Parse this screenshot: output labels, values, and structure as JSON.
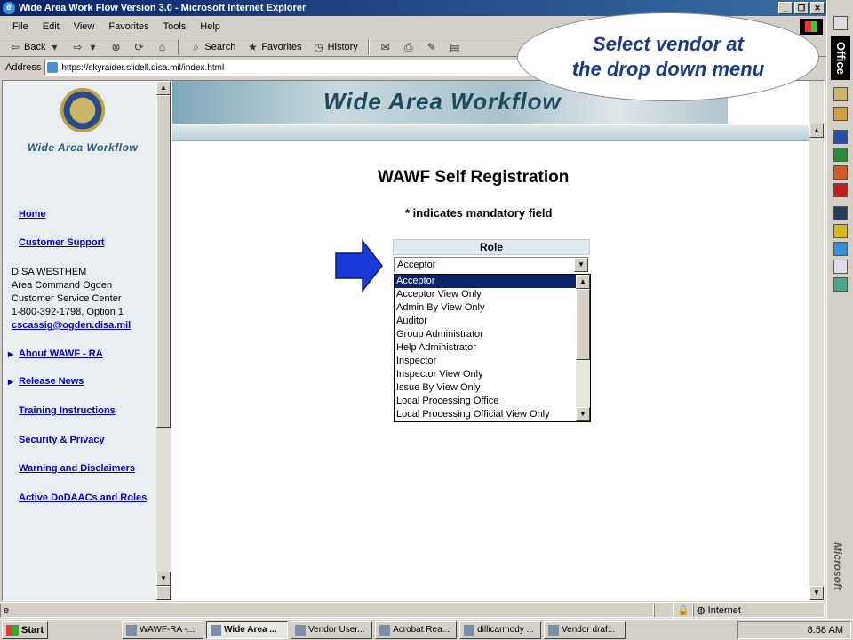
{
  "window": {
    "title": "Wide Area Work Flow Version 3.0 - Microsoft Internet Explorer",
    "controls": [
      "_",
      "❐",
      "✕"
    ]
  },
  "menu": [
    "File",
    "Edit",
    "View",
    "Favorites",
    "Tools",
    "Help"
  ],
  "toolbar": {
    "back": "Back",
    "search": "Search",
    "favorites": "Favorites",
    "history": "History"
  },
  "address": {
    "label": "Address",
    "url": "https://skyraider.slidell.disa.mil/index.html"
  },
  "callout": {
    "line1": "Select vendor at",
    "line2": "the drop down menu"
  },
  "sidebar": {
    "logo_text": "Wide Area Workflow",
    "links": {
      "home": "Home",
      "support": "Customer Support",
      "about": "About WAWF - RA",
      "release": "Release News",
      "training": "Training Instructions",
      "security": "Security & Privacy",
      "warning": "Warning and Disclaimers",
      "active": "Active DoDAACs and Roles"
    },
    "contact": {
      "line1": "DISA WESTHEM",
      "line2": "Area Command Ogden",
      "line3": "Customer Service Center",
      "line4": "1-800-392-1798, Option 1",
      "email": "cscassig@ogden.disa.mil"
    }
  },
  "banner": {
    "title": "Wide Area Workflow"
  },
  "form": {
    "title": "WAWF Self Registration",
    "subtitle": "* indicates mandatory field",
    "role_label": "Role",
    "selected_role": "Acceptor",
    "options": [
      "Acceptor",
      "Acceptor View Only",
      "Admin By View Only",
      "Auditor",
      "Group Administrator",
      "Help Administrator",
      "Inspector",
      "Inspector View Only",
      "Issue By View Only",
      "Local Processing Office",
      "Local Processing Official View Only"
    ]
  },
  "status": {
    "zone": "Internet"
  },
  "taskbar": {
    "start": "Start",
    "tasks": [
      "WAWF-RA -...",
      "Wide Area ...",
      "Vendor User...",
      "Acrobat Rea...",
      "dillicarmody ...",
      "Vendor draf..."
    ],
    "clock": "8:58 AM"
  },
  "officebar": {
    "label": "Office",
    "brand": "Microsoft"
  }
}
